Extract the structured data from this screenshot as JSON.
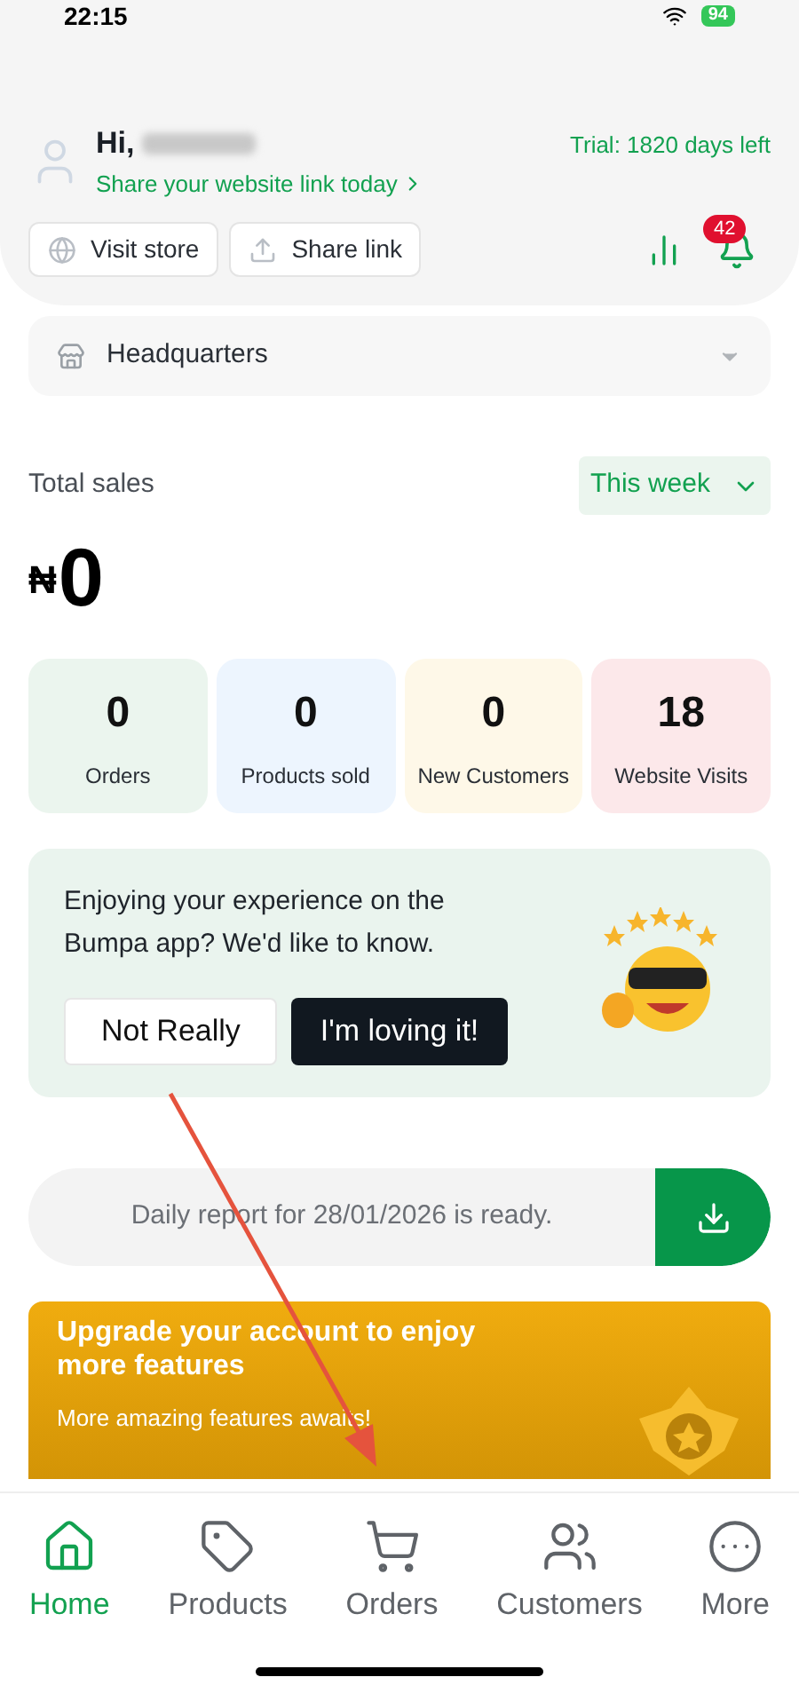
{
  "status_bar": {
    "time": "22:15",
    "battery": "94"
  },
  "header": {
    "greeting": "Hi,",
    "name_blurred": true,
    "share_link_text": "Share your website link today",
    "trial": "Trial: 1820 days left",
    "buttons": [
      {
        "kind": "globe",
        "label": "Visit store"
      },
      {
        "kind": "share",
        "label": "Share link"
      }
    ],
    "notifications": "42"
  },
  "store_select": {
    "value": "Headquarters"
  },
  "sales": {
    "label": "Total sales",
    "currency": "₦",
    "amount": "0",
    "period": "This week"
  },
  "stats": [
    {
      "value": "0",
      "label": "Orders",
      "color": "#ebf5ee"
    },
    {
      "value": "0",
      "label": "Products sold",
      "color": "#edf5fe"
    },
    {
      "value": "0",
      "label": "New Customers",
      "color": "#fef8e8"
    },
    {
      "value": "18",
      "label": "Website Visits",
      "color": "#fce8ea"
    }
  ],
  "feedback": {
    "text": "Enjoying your experience on the Bumpa app? We'd like to know.",
    "buttons": [
      {
        "label": "Not Really",
        "kind": "secondary"
      },
      {
        "label": "I'm loving it!",
        "kind": "primary"
      }
    ]
  },
  "report": {
    "text": "Daily report for 28/01/2026 is ready."
  },
  "upgrade": {
    "title": "Upgrade your account to enjoy more features",
    "subtitle": "More amazing features awaits!"
  },
  "nav": [
    {
      "kind": "home",
      "label": "Home",
      "selected": true
    },
    {
      "kind": "tag",
      "label": "Products",
      "selected": false
    },
    {
      "kind": "cart",
      "label": "Orders",
      "selected": false
    },
    {
      "kind": "people",
      "label": "Customers",
      "selected": false
    },
    {
      "kind": "more",
      "label": "More",
      "selected": false
    }
  ]
}
